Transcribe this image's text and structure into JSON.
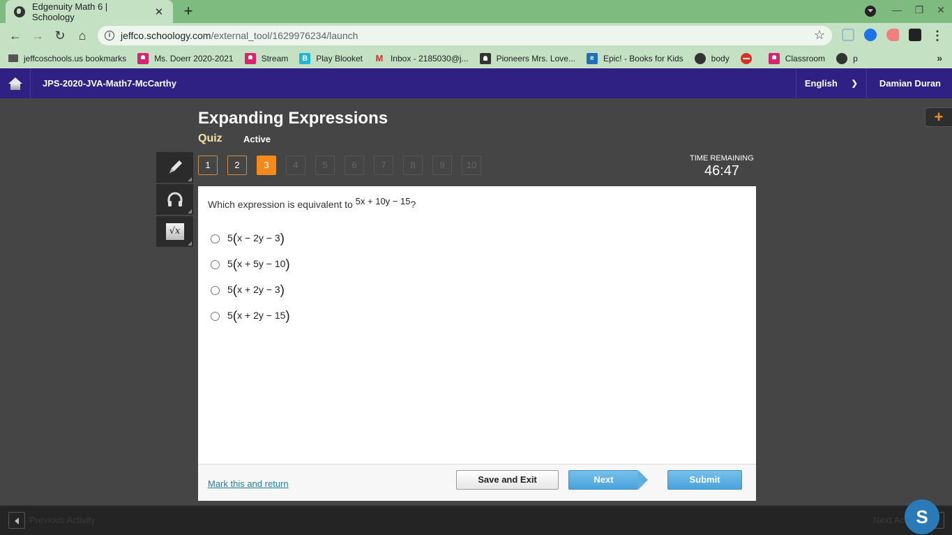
{
  "browser": {
    "tab_title": "Edgenuity Math 6 | Schoology",
    "tab_icon": "globe-icon",
    "new_tab_label": "+",
    "url_host": "jeffco.schoology.com",
    "url_path": "/external_tool/1629976234/launch",
    "window_controls": {
      "minimize": "—",
      "restore": "❐",
      "close": "✕"
    },
    "nav": {
      "back": "←",
      "forward": "→",
      "reload": "↻",
      "home": "⌂"
    },
    "star": "☆",
    "menu": "⋮",
    "bookmarks": [
      {
        "label": "jeffcoschools.us bookmarks",
        "icon": "folder"
      },
      {
        "label": "Ms. Doerr 2020-2021",
        "icon": "classroom"
      },
      {
        "label": "Stream",
        "icon": "classroom"
      },
      {
        "label": "Play Blooket",
        "icon": "blooket"
      },
      {
        "label": "Inbox - 2185030@j...",
        "icon": "gmail"
      },
      {
        "label": "Pioneers Mrs. Love...",
        "icon": "dark"
      },
      {
        "label": "Epic! - Books for Kids",
        "icon": "epic"
      },
      {
        "label": "body",
        "icon": "globe"
      },
      {
        "label": "",
        "icon": "nope"
      },
      {
        "label": "Classroom",
        "icon": "classroom"
      },
      {
        "label": "p",
        "icon": "globe"
      }
    ],
    "bookmarks_more": "»"
  },
  "schoology": {
    "course_title": "JPS-2020-JVA-Math7-McCarthy",
    "language": "English",
    "language_chevron": "⌄",
    "user_name": "Damian Duran"
  },
  "lesson": {
    "title": "Expanding Expressions",
    "type": "Quiz",
    "status": "Active",
    "plus_label": "+",
    "questions": [
      {
        "label": "1",
        "state": "done"
      },
      {
        "label": "2",
        "state": "done"
      },
      {
        "label": "3",
        "state": "current"
      },
      {
        "label": "4",
        "state": "locked"
      },
      {
        "label": "5",
        "state": "locked"
      },
      {
        "label": "6",
        "state": "locked"
      },
      {
        "label": "7",
        "state": "locked"
      },
      {
        "label": "8",
        "state": "locked"
      },
      {
        "label": "9",
        "state": "locked"
      },
      {
        "label": "10",
        "state": "locked"
      }
    ],
    "timer_label": "TIME REMAINING",
    "timer_value": "46:47",
    "tools": [
      {
        "name": "pencil-tool",
        "icon": "pencil-icon"
      },
      {
        "name": "audio-tool",
        "icon": "headphones-icon"
      },
      {
        "name": "calculator-tool",
        "icon": "square-root-icon",
        "glyph": "√x"
      }
    ]
  },
  "question": {
    "prompt": "Which expression is equivalent to ",
    "expression": "5x + 10y − 15",
    "prompt_end": "?",
    "answers": [
      {
        "coef": "5",
        "inner": "x − 2y − 3"
      },
      {
        "coef": "5",
        "inner": "x + 5y − 10"
      },
      {
        "coef": "5",
        "inner": "x + 2y − 3"
      },
      {
        "coef": "5",
        "inner": "x + 2y − 15"
      }
    ]
  },
  "footer": {
    "mark_link": "Mark this and return",
    "save_exit": "Save and Exit",
    "next": "Next",
    "submit": "Submit"
  },
  "activity_bar": {
    "previous": "Previous Activity",
    "next": "Next Activity",
    "chat_bubble": "S"
  }
}
